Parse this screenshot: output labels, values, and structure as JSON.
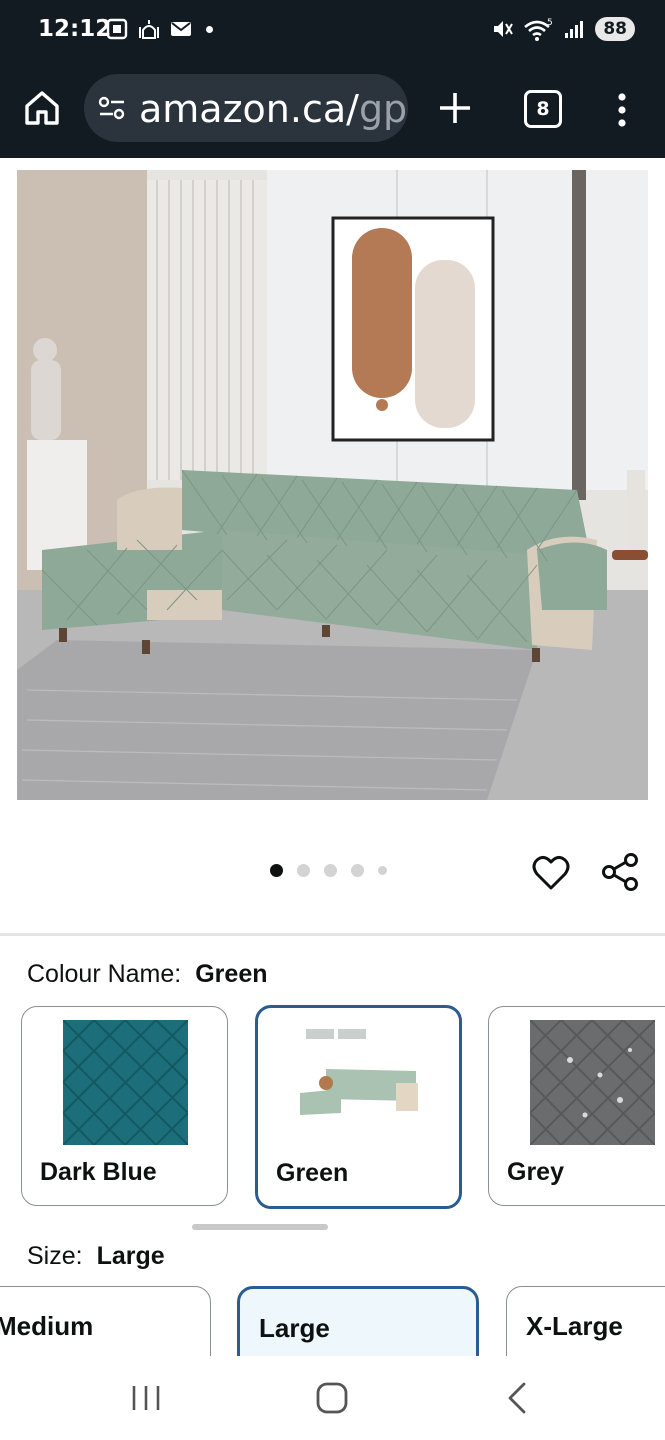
{
  "status_bar": {
    "time": "12:12",
    "battery": "88",
    "signal_label": "5"
  },
  "browser": {
    "url_main": "amazon.ca/",
    "url_faded": "gp/",
    "tab_count": "8"
  },
  "gallery": {
    "image_alt": "Green quilted L-shaped sectional sofa cover in a living room",
    "dot_count": 5,
    "active_dot": 0
  },
  "colour": {
    "label": "Colour Name:",
    "selected": "Green",
    "options": [
      {
        "name": "Dark Blue",
        "color": "#1b6e7a"
      },
      {
        "name": "Green",
        "color": "#a9c2b2"
      },
      {
        "name": "Grey",
        "color": "#6b6c6e"
      }
    ]
  },
  "size": {
    "label": "Size:",
    "selected": "Large",
    "options": [
      "Medium",
      "Large",
      "X-Large"
    ]
  },
  "colors": {
    "accent": "#2a5c92",
    "chrome": "#121a22",
    "sofa": "#8fa998"
  }
}
